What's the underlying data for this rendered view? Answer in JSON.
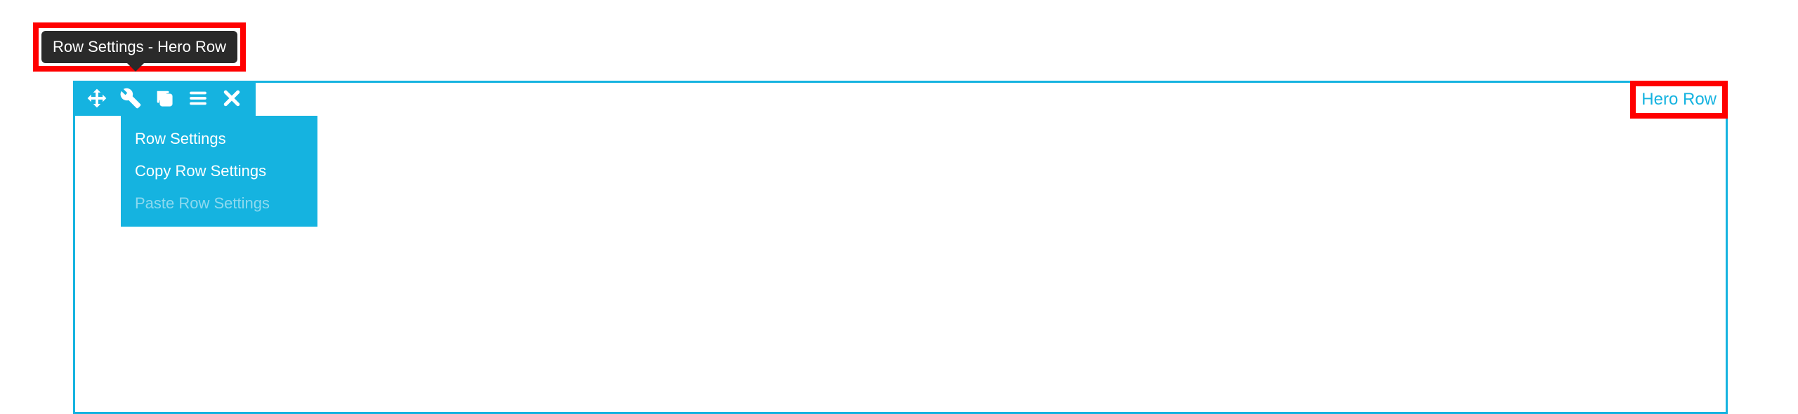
{
  "tooltip": {
    "text": "Row Settings - Hero Row"
  },
  "toolbar": {
    "icons": {
      "move": "move-icon",
      "wrench": "wrench-icon",
      "copy": "copy-icon",
      "menu": "menu-icon",
      "close": "close-icon"
    }
  },
  "dropdown": {
    "items": [
      {
        "label": "Row Settings",
        "enabled": true
      },
      {
        "label": "Copy Row Settings",
        "enabled": true
      },
      {
        "label": "Paste Row Settings",
        "enabled": false
      }
    ]
  },
  "row": {
    "label": "Hero Row"
  },
  "colors": {
    "accent": "#15b3e0",
    "highlight": "#ff0000",
    "tooltip_bg": "#2a2a2a"
  }
}
